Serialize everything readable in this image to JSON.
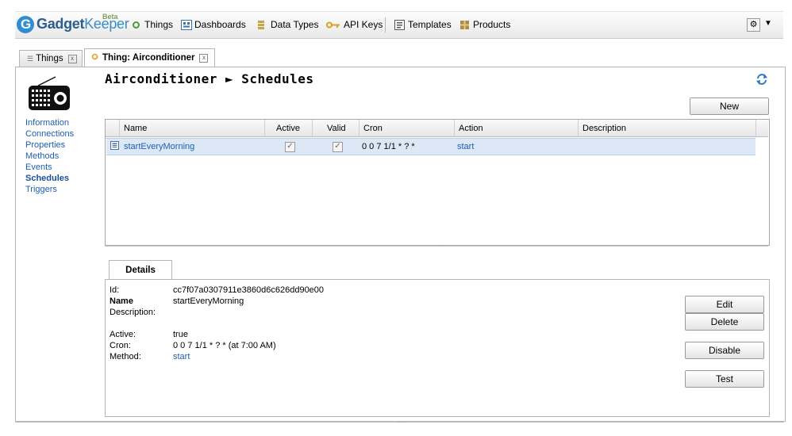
{
  "brand": {
    "logo_letter": "G",
    "name_a": "Gadget",
    "name_b": "Keeper",
    "beta": "Beta"
  },
  "nav": [
    {
      "label": "Things",
      "icon": "circle-icon"
    },
    {
      "label": "Dashboards",
      "icon": "dashboard-icon"
    },
    {
      "label": "Data Types",
      "icon": "datatypes-icon"
    },
    {
      "label": "API Keys",
      "icon": "key-icon"
    },
    {
      "label": "Templates",
      "icon": "template-icon"
    },
    {
      "label": "Products",
      "icon": "product-icon"
    }
  ],
  "tabs": {
    "things": "Things",
    "current": "Thing: Airconditioner",
    "close": "x"
  },
  "thing": {
    "name": "Airconditioner",
    "arrow": "►",
    "section": "Schedules"
  },
  "side_menu": [
    "Information",
    "Connections",
    "Properties",
    "Methods",
    "Events",
    "Schedules",
    "Triggers"
  ],
  "side_selected": "Schedules",
  "buttons": {
    "new": "New",
    "edit": "Edit",
    "delete": "Delete",
    "disable": "Disable",
    "test": "Test"
  },
  "grid": {
    "columns": [
      "Name",
      "Active",
      "Valid",
      "Cron",
      "Action",
      "Description"
    ],
    "rows": [
      {
        "name": "startEveryMorning",
        "active": true,
        "valid": true,
        "cron": "0 0 7 1/1 * ? *",
        "action": "start",
        "description": ""
      }
    ]
  },
  "details": {
    "tab": "Details",
    "labels": {
      "id": "Id:",
      "name": "Name",
      "description": "Description:",
      "active": "Active:",
      "cron": "Cron:",
      "method": "Method:"
    },
    "id": "cc7f07a0307911e3860d6c626dd90e00",
    "name": "startEveryMorning",
    "description": "",
    "active": "true",
    "cron": "0 0 7 1/1 * ? * (at 7:00 AM)",
    "method": "start"
  },
  "grip": "....."
}
